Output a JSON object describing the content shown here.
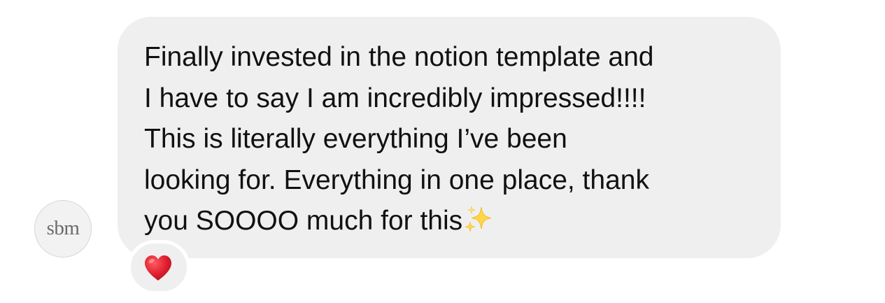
{
  "sender": {
    "avatar_initials": "sbm"
  },
  "message": {
    "lines": [
      "Finally invested in the notion template and",
      "I have to say I am incredibly impressed!!!!",
      "This is literally everything I’ve been",
      "looking for. Everything in one place, thank",
      "you SOOOO much for this"
    ],
    "trailing_emoji": "sparkles-icon"
  },
  "reaction": {
    "emoji": "heart-icon",
    "color": "#e0202f"
  },
  "colors": {
    "bubble": "#efefef",
    "text": "#111111",
    "background": "#ffffff"
  }
}
